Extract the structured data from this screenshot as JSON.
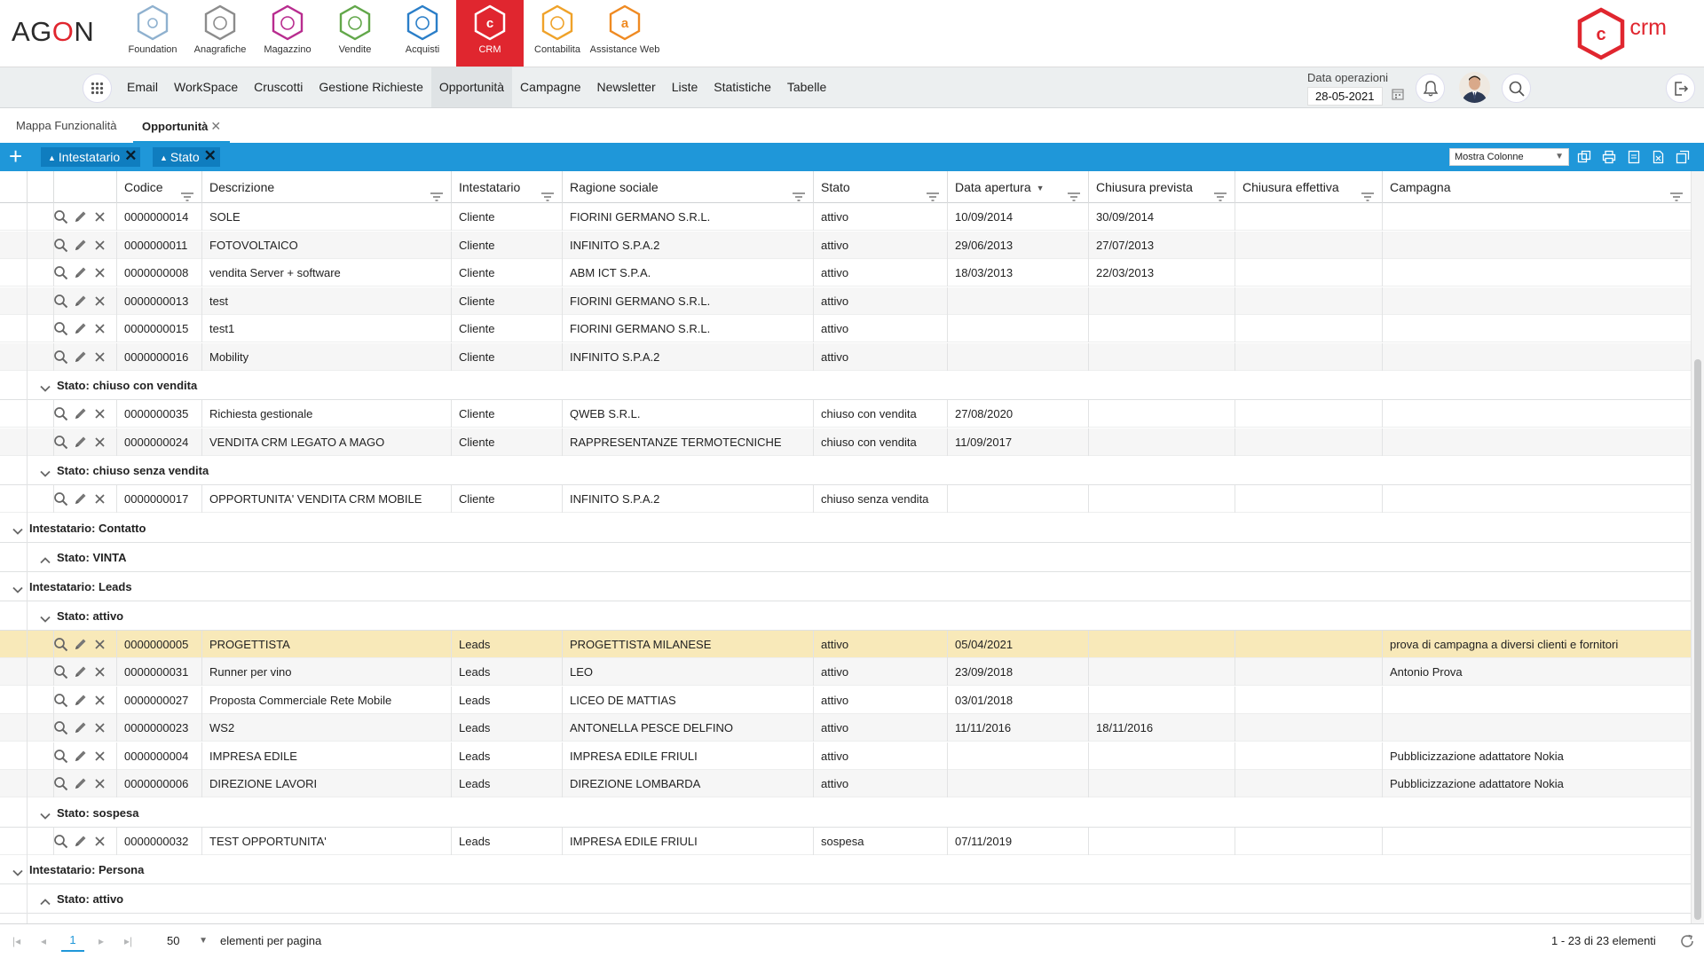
{
  "brand": {
    "logo_pre": "AG",
    "logo_o": "O",
    "logo_post": "N",
    "crm_text": "crm",
    "crm_letter": "c",
    "accent": "#e0262f",
    "blue": "#1f97d9"
  },
  "modules": [
    {
      "label": "Foundation",
      "icon": "foundation-icon",
      "color": "#8fb1cf",
      "letter": ""
    },
    {
      "label": "Anagrafiche",
      "icon": "anagrafiche-icon",
      "color": "#8c8c8c",
      "letter": ""
    },
    {
      "label": "Magazzino",
      "icon": "magazzino-icon",
      "color": "#b82c8f",
      "letter": ""
    },
    {
      "label": "Vendite",
      "icon": "vendite-icon",
      "color": "#62a74a",
      "letter": ""
    },
    {
      "label": "Acquisti",
      "icon": "acquisti-icon",
      "color": "#2a7ec8",
      "letter": ""
    },
    {
      "label": "CRM",
      "icon": "crm-icon",
      "color": "#ffffff",
      "letter": "c",
      "active": true
    },
    {
      "label": "Contabilita",
      "icon": "contabilita-icon",
      "color": "#efa229",
      "letter": ""
    },
    {
      "label": "Assistance Web",
      "icon": "assistance-icon",
      "color": "#ef8a22",
      "letter": "a"
    }
  ],
  "menu": [
    "Email",
    "WorkSpace",
    "Cruscotti",
    "Gestione Richieste",
    "Opportunità",
    "Campagne",
    "Newsletter",
    "Liste",
    "Statistiche",
    "Tabelle"
  ],
  "menu_active_index": 4,
  "data_operazioni": {
    "label": "Data operazioni",
    "value": "28-05-2021"
  },
  "tabs": {
    "mappa": "Mappa Funzionalità",
    "opportunita": "Opportunità",
    "close": "✕"
  },
  "toolbar": {
    "plus": "+",
    "chips": [
      "Intestatario",
      "Stato"
    ],
    "chip_x": "✕",
    "mostra_colonne": "Mostra Colonne"
  },
  "columns": [
    {
      "key": "codice",
      "label": "Codice"
    },
    {
      "key": "descrizione",
      "label": "Descrizione"
    },
    {
      "key": "intestatario",
      "label": "Intestatario"
    },
    {
      "key": "ragione",
      "label": "Ragione sociale"
    },
    {
      "key": "stato",
      "label": "Stato"
    },
    {
      "key": "apertura",
      "label": "Data apertura",
      "sorted": true
    },
    {
      "key": "chiusura_prev",
      "label": "Chiusura prevista"
    },
    {
      "key": "chiusura_eff",
      "label": "Chiusura effettiva"
    },
    {
      "key": "campagna",
      "label": "Campagna"
    }
  ],
  "rows": [
    {
      "type": "data",
      "codice": "0000000014",
      "descrizione": "SOLE",
      "intestatario": "Cliente",
      "ragione": "FIORINI GERMANO S.R.L.",
      "stato": "attivo",
      "apertura": "10/09/2014",
      "chiusura_prev": "30/09/2014",
      "chiusura_eff": "",
      "campagna": ""
    },
    {
      "type": "data",
      "codice": "0000000011",
      "descrizione": "FOTOVOLTAICO",
      "intestatario": "Cliente",
      "ragione": "INFINITO S.P.A.2",
      "stato": "attivo",
      "apertura": "29/06/2013",
      "chiusura_prev": "27/07/2013",
      "chiusura_eff": "",
      "campagna": ""
    },
    {
      "type": "data",
      "codice": "0000000008",
      "descrizione": "vendita Server + software",
      "intestatario": "Cliente",
      "ragione": "ABM ICT S.P.A.",
      "stato": "attivo",
      "apertura": "18/03/2013",
      "chiusura_prev": "22/03/2013",
      "chiusura_eff": "",
      "campagna": ""
    },
    {
      "type": "data",
      "codice": "0000000013",
      "descrizione": "test",
      "intestatario": "Cliente",
      "ragione": "FIORINI GERMANO S.R.L.",
      "stato": "attivo",
      "apertura": "",
      "chiusura_prev": "",
      "chiusura_eff": "",
      "campagna": ""
    },
    {
      "type": "data",
      "codice": "0000000015",
      "descrizione": "test1",
      "intestatario": "Cliente",
      "ragione": "FIORINI GERMANO S.R.L.",
      "stato": "attivo",
      "apertura": "",
      "chiusura_prev": "",
      "chiusura_eff": "",
      "campagna": ""
    },
    {
      "type": "data",
      "codice": "0000000016",
      "descrizione": "Mobility",
      "intestatario": "Cliente",
      "ragione": "INFINITO S.P.A.2",
      "stato": "attivo",
      "apertura": "",
      "chiusura_prev": "",
      "chiusura_eff": "",
      "campagna": ""
    },
    {
      "type": "group2",
      "label": "Stato: chiuso con vendita",
      "expanded": true
    },
    {
      "type": "data",
      "codice": "0000000035",
      "descrizione": "Richiesta gestionale",
      "intestatario": "Cliente",
      "ragione": "QWEB S.R.L.",
      "stato": "chiuso con vendita",
      "apertura": "27/08/2020",
      "chiusura_prev": "",
      "chiusura_eff": "",
      "campagna": ""
    },
    {
      "type": "data",
      "codice": "0000000024",
      "descrizione": "VENDITA CRM LEGATO A MAGO",
      "intestatario": "Cliente",
      "ragione": "RAPPRESENTANZE TERMOTECNICHE",
      "stato": "chiuso con vendita",
      "apertura": "11/09/2017",
      "chiusura_prev": "",
      "chiusura_eff": "",
      "campagna": ""
    },
    {
      "type": "group2",
      "label": "Stato: chiuso senza vendita",
      "expanded": true
    },
    {
      "type": "data",
      "codice": "0000000017",
      "descrizione": "OPPORTUNITA' VENDITA CRM MOBILE",
      "intestatario": "Cliente",
      "ragione": "INFINITO S.P.A.2",
      "stato": "chiuso senza vendita",
      "apertura": "",
      "chiusura_prev": "",
      "chiusura_eff": "",
      "campagna": ""
    },
    {
      "type": "group1",
      "label": "Intestatario: Contatto",
      "expanded": true
    },
    {
      "type": "group2",
      "label": "Stato: VINTA",
      "expanded": false
    },
    {
      "type": "group1",
      "label": "Intestatario: Leads",
      "expanded": true
    },
    {
      "type": "group2",
      "label": "Stato: attivo",
      "expanded": true
    },
    {
      "type": "data",
      "selected": true,
      "codice": "0000000005",
      "descrizione": "PROGETTISTA",
      "intestatario": "Leads",
      "ragione": "PROGETTISTA MILANESE",
      "stato": "attivo",
      "apertura": "05/04/2021",
      "chiusura_prev": "",
      "chiusura_eff": "",
      "campagna": "prova di campagna a diversi clienti e fornitori"
    },
    {
      "type": "data",
      "codice": "0000000031",
      "descrizione": "Runner per vino",
      "intestatario": "Leads",
      "ragione": "LEO",
      "stato": "attivo",
      "apertura": "23/09/2018",
      "chiusura_prev": "",
      "chiusura_eff": "",
      "campagna": "Antonio Prova"
    },
    {
      "type": "data",
      "codice": "0000000027",
      "descrizione": "Proposta Commerciale Rete Mobile",
      "intestatario": "Leads",
      "ragione": "LICEO DE MATTIAS",
      "stato": "attivo",
      "apertura": "03/01/2018",
      "chiusura_prev": "",
      "chiusura_eff": "",
      "campagna": ""
    },
    {
      "type": "data",
      "codice": "0000000023",
      "descrizione": "WS2",
      "intestatario": "Leads",
      "ragione": "ANTONELLA PESCE DELFINO",
      "stato": "attivo",
      "apertura": "11/11/2016",
      "chiusura_prev": "18/11/2016",
      "chiusura_eff": "",
      "campagna": ""
    },
    {
      "type": "data",
      "codice": "0000000004",
      "descrizione": "IMPRESA EDILE",
      "intestatario": "Leads",
      "ragione": "IMPRESA EDILE FRIULI",
      "stato": "attivo",
      "apertura": "",
      "chiusura_prev": "",
      "chiusura_eff": "",
      "campagna": "Pubblicizzazione adattatore Nokia"
    },
    {
      "type": "data",
      "codice": "0000000006",
      "descrizione": "DIREZIONE LAVORI",
      "intestatario": "Leads",
      "ragione": "DIREZIONE LOMBARDA",
      "stato": "attivo",
      "apertura": "",
      "chiusura_prev": "",
      "chiusura_eff": "",
      "campagna": "Pubblicizzazione adattatore Nokia"
    },
    {
      "type": "group2",
      "label": "Stato: sospesa",
      "expanded": true
    },
    {
      "type": "data",
      "codice": "0000000032",
      "descrizione": "TEST OPPORTUNITA'",
      "intestatario": "Leads",
      "ragione": "IMPRESA EDILE FRIULI",
      "stato": "sospesa",
      "apertura": "07/11/2019",
      "chiusura_prev": "",
      "chiusura_eff": "",
      "campagna": ""
    },
    {
      "type": "group1",
      "label": "Intestatario: Persona",
      "expanded": true
    },
    {
      "type": "group2",
      "label": "Stato: attivo",
      "expanded": false
    }
  ],
  "pager": {
    "current": "1",
    "page_size": "50",
    "per_page_label": "elementi per pagina",
    "summary": "1 - 23 di 23 elementi"
  }
}
